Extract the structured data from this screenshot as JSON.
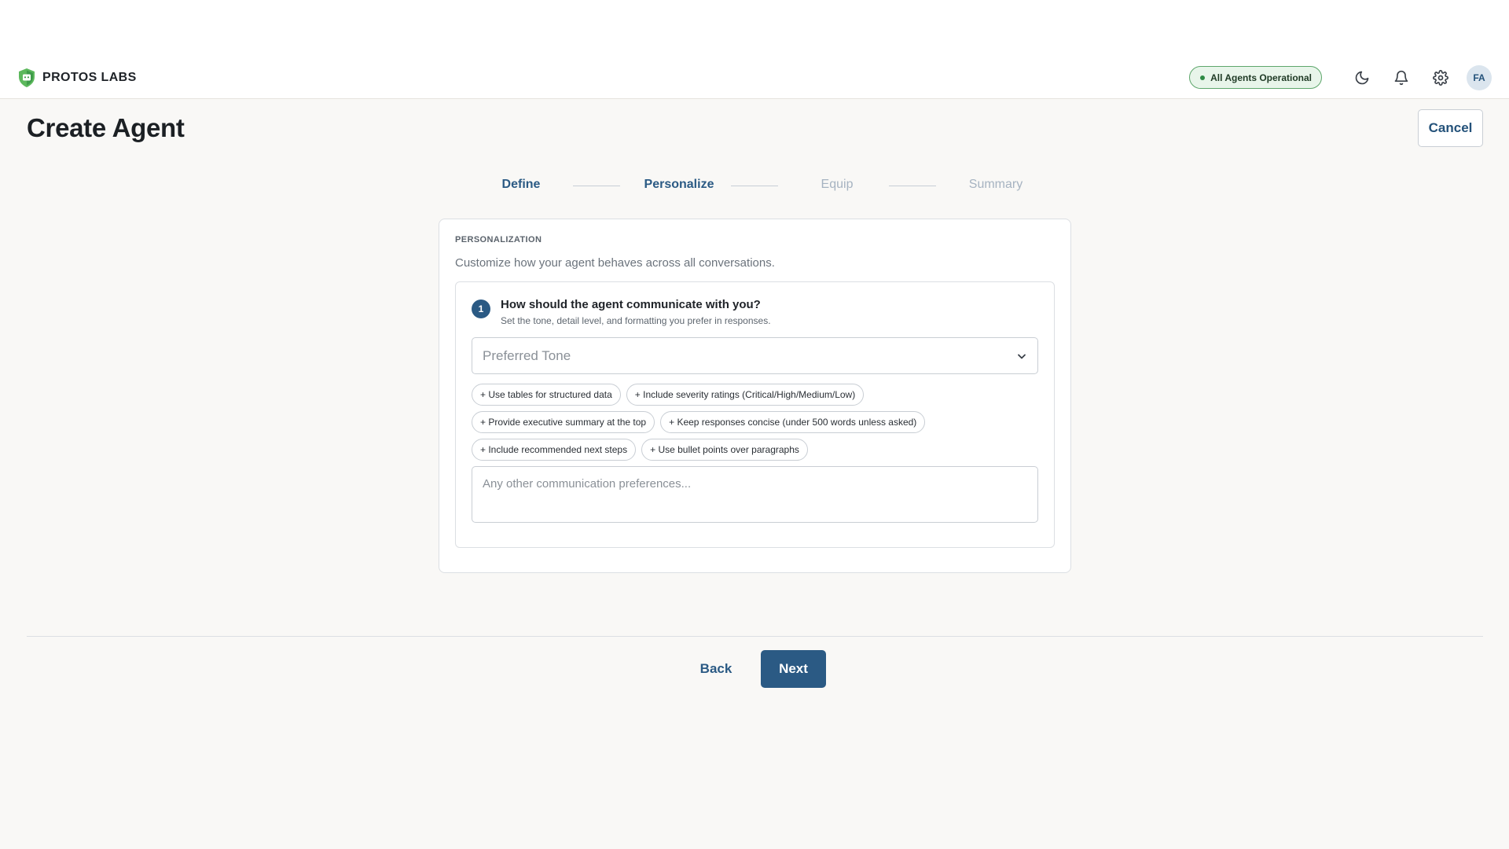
{
  "app": {
    "brand_name": "PROTOS LABS"
  },
  "header": {
    "status_label": "All Agents Operational",
    "status_color": "#2e8b45",
    "icons": [
      "moon-icon",
      "bell-icon",
      "gear-icon"
    ],
    "avatar_initials": "FA"
  },
  "page": {
    "title": "Create Agent",
    "cancel_label": "Cancel"
  },
  "stepper": {
    "current": "Personalize",
    "steps": [
      {
        "label": "Define",
        "state": "done"
      },
      {
        "label": "Personalize",
        "state": "current"
      },
      {
        "label": "Equip",
        "state": "future"
      },
      {
        "label": "Summary",
        "state": "future"
      }
    ]
  },
  "card": {
    "section_label": "PERSONALIZATION",
    "description": "Customize how your agent behaves across all conversations.",
    "question": {
      "number": "1",
      "title": "How should the agent communicate with you?",
      "subtitle": "Set the tone, detail level, and formatting you prefer in responses.",
      "select_placeholder": "Preferred Tone",
      "chips": [
        [
          "+ Use tables for structured data",
          "+ Include severity ratings (Critical/High/Medium/Low)"
        ],
        [
          "+ Provide executive summary at the top",
          "+ Keep responses concise (under 500 words unless asked)"
        ],
        [
          "+ Include recommended next steps",
          "+ Use bullet points over paragraphs"
        ]
      ],
      "textarea_placeholder": "Any other communication preferences..."
    }
  },
  "footer": {
    "back_label": "Back",
    "next_label": "Next"
  },
  "colors": {
    "accent": "#2b5a84",
    "background": "#f9f8f6",
    "status_bg": "#e8f5ea"
  }
}
